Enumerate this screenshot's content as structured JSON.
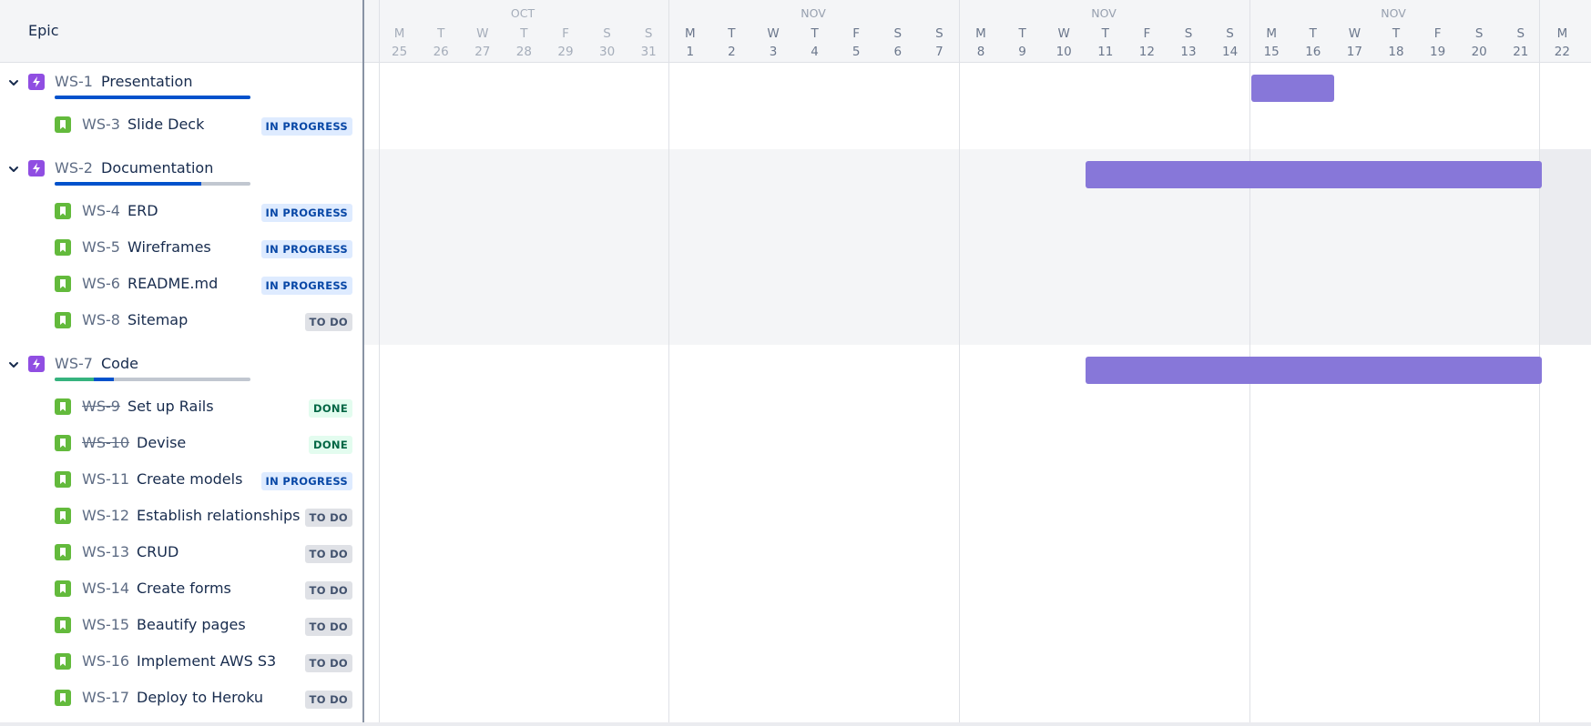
{
  "header": {
    "epic_label": "Epic"
  },
  "calendar": {
    "months": [
      {
        "label": "OCT",
        "muted": true
      },
      {
        "label": "NOV",
        "muted": false
      },
      {
        "label": "NOV",
        "muted": false
      },
      {
        "label": "NOV",
        "muted": false
      }
    ],
    "days": [
      {
        "letter": "M",
        "num": "25",
        "muted": true
      },
      {
        "letter": "T",
        "num": "26",
        "muted": true
      },
      {
        "letter": "W",
        "num": "27",
        "muted": true
      },
      {
        "letter": "T",
        "num": "28",
        "muted": true
      },
      {
        "letter": "F",
        "num": "29",
        "muted": true
      },
      {
        "letter": "S",
        "num": "30",
        "muted": true
      },
      {
        "letter": "S",
        "num": "31",
        "muted": true
      },
      {
        "letter": "M",
        "num": "1",
        "muted": false
      },
      {
        "letter": "T",
        "num": "2",
        "muted": false
      },
      {
        "letter": "W",
        "num": "3",
        "muted": false
      },
      {
        "letter": "T",
        "num": "4",
        "muted": false
      },
      {
        "letter": "F",
        "num": "5",
        "muted": false
      },
      {
        "letter": "S",
        "num": "6",
        "muted": false
      },
      {
        "letter": "S",
        "num": "7",
        "muted": false
      },
      {
        "letter": "M",
        "num": "8",
        "muted": false
      },
      {
        "letter": "T",
        "num": "9",
        "muted": false
      },
      {
        "letter": "W",
        "num": "10",
        "muted": false
      },
      {
        "letter": "T",
        "num": "11",
        "muted": false
      },
      {
        "letter": "F",
        "num": "12",
        "muted": false
      },
      {
        "letter": "S",
        "num": "13",
        "muted": false
      },
      {
        "letter": "S",
        "num": "14",
        "muted": false
      },
      {
        "letter": "M",
        "num": "15",
        "muted": false
      },
      {
        "letter": "T",
        "num": "16",
        "muted": false
      },
      {
        "letter": "W",
        "num": "17",
        "muted": false
      },
      {
        "letter": "T",
        "num": "18",
        "muted": false
      },
      {
        "letter": "F",
        "num": "19",
        "muted": false
      },
      {
        "letter": "S",
        "num": "20",
        "muted": false
      },
      {
        "letter": "S",
        "num": "21",
        "muted": false
      },
      {
        "letter": "M",
        "num": "22",
        "muted": false
      }
    ]
  },
  "epics": [
    {
      "key": "WS-1",
      "summary": "Presentation",
      "progress": {
        "done": 0,
        "in_progress": 1.0
      },
      "bar": {
        "start": "Nov 15",
        "end": "Nov 16"
      },
      "issues": [
        {
          "key": "WS-3",
          "summary": "Slide Deck",
          "status": "IN PROGRESS",
          "kind": "prog"
        }
      ]
    },
    {
      "key": "WS-2",
      "summary": "Documentation",
      "progress": {
        "done": 0,
        "in_progress": 0.75
      },
      "bar": {
        "start": "Nov 11",
        "end": "Nov 21"
      },
      "issues": [
        {
          "key": "WS-4",
          "summary": "ERD",
          "status": "IN PROGRESS",
          "kind": "prog"
        },
        {
          "key": "WS-5",
          "summary": "Wireframes",
          "status": "IN PROGRESS",
          "kind": "prog"
        },
        {
          "key": "WS-6",
          "summary": "README.md",
          "status": "IN PROGRESS",
          "kind": "prog"
        },
        {
          "key": "WS-8",
          "summary": "Sitemap",
          "status": "TO DO",
          "kind": "todo"
        }
      ]
    },
    {
      "key": "WS-7",
      "summary": "Code",
      "progress": {
        "done": 0.2,
        "in_progress": 0.1
      },
      "bar": {
        "start": "Nov 11",
        "end": "Nov 21"
      },
      "issues": [
        {
          "key": "WS-9",
          "summary": "Set up Rails",
          "status": "DONE",
          "kind": "done"
        },
        {
          "key": "WS-10",
          "summary": "Devise",
          "status": "DONE",
          "kind": "done"
        },
        {
          "key": "WS-11",
          "summary": "Create models",
          "status": "IN PROGRESS",
          "kind": "prog"
        },
        {
          "key": "WS-12",
          "summary": "Establish relationships",
          "status": "TO DO",
          "kind": "todo"
        },
        {
          "key": "WS-13",
          "summary": "CRUD",
          "status": "TO DO",
          "kind": "todo"
        },
        {
          "key": "WS-14",
          "summary": "Create forms",
          "status": "TO DO",
          "kind": "todo"
        },
        {
          "key": "WS-15",
          "summary": "Beautify pages",
          "status": "TO DO",
          "kind": "todo"
        },
        {
          "key": "WS-16",
          "summary": "Implement AWS S3",
          "status": "TO DO",
          "kind": "todo"
        },
        {
          "key": "WS-17",
          "summary": "Deploy to Heroku",
          "status": "TO DO",
          "kind": "todo"
        }
      ]
    }
  ],
  "colors": {
    "epic_icon": "#904ee2",
    "story_icon": "#63ba3c",
    "bar": "#8777d9",
    "progress_done": "#36b37e",
    "progress_in_progress": "#0052cc",
    "progress_todo": "#c1c7d0"
  }
}
